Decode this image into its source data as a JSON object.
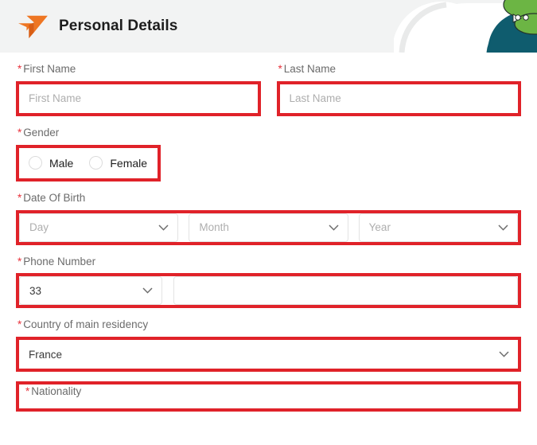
{
  "header": {
    "title": "Personal Details",
    "logo_icon": "arrow-logo-icon",
    "logo_color": "#EE7623",
    "background": "#F2F3F3",
    "art_icon": "decorative-illustration"
  },
  "theme": {
    "highlight_color": "#E02229",
    "required_marker": "*",
    "label_color": "#6B6B6B",
    "placeholder_color": "#AEAEAE"
  },
  "form": {
    "first_name": {
      "label": "First Name",
      "placeholder": "First Name",
      "value": ""
    },
    "last_name": {
      "label": "Last Name",
      "placeholder": "Last Name",
      "value": ""
    },
    "gender": {
      "label": "Gender",
      "options": [
        {
          "label": "Male",
          "selected": false
        },
        {
          "label": "Female",
          "selected": false
        }
      ]
    },
    "date_of_birth": {
      "label": "Date Of Birth",
      "day": {
        "placeholder": "Day",
        "value": ""
      },
      "month": {
        "placeholder": "Month",
        "value": ""
      },
      "year": {
        "placeholder": "Year",
        "value": ""
      }
    },
    "phone_number": {
      "label": "Phone Number",
      "country_code": "33",
      "number": ""
    },
    "country_of_residency": {
      "label": "Country of main residency",
      "value": "France"
    },
    "nationality": {
      "label": "Nationality",
      "value": ""
    }
  }
}
